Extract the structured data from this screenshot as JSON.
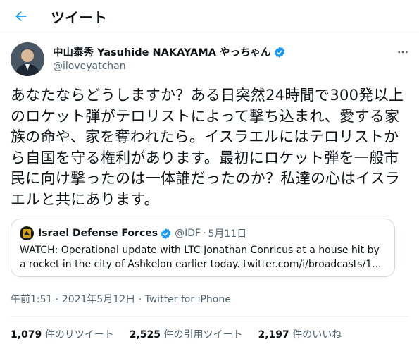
{
  "header": {
    "title": "ツイート"
  },
  "author": {
    "display_name": "中山泰秀 Yasuhide NAKAYAMA やっちゃん",
    "handle": "@iloveyatchan"
  },
  "tweet": {
    "text": "あなたならどうしますか？ある日突然24時間で300発以上のロケット弾がテロリストによって撃ち込まれ、愛する家族の命や、家を奪われたら。イスラエルにはテロリストから自国を守る権利があります。最初にロケット弾を一般市民に向け撃ったのは一体誰だったのか？私達の心はイスラエルと共にあります。"
  },
  "quote": {
    "name": "Israel Defense Forces",
    "handle": "@IDF",
    "dot": "·",
    "date": "5月11日",
    "text": "WATCH: Operational update with LTC Jonathan Conricus at a house hit by a rocket in the city of Ashkelon earlier today. twitter.com/i/broadcasts/1..."
  },
  "meta": {
    "time": "午前1:51 · 2021年5月12日 · ",
    "source": "Twitter for iPhone"
  },
  "stats": {
    "retweets_count": "1,079",
    "retweets_label": " 件のリツイート",
    "quotes_count": "2,525",
    "quotes_label": " 件の引用ツイート",
    "likes_count": "2,197",
    "likes_label": " 件のいいね"
  },
  "colors": {
    "accent": "#1d9bf0",
    "secondary_text": "#536471",
    "border": "#cfd9de"
  },
  "icons": {
    "back": "arrow-left-icon",
    "verified": "verified-badge-icon",
    "more": "more-horizontal-icon"
  }
}
